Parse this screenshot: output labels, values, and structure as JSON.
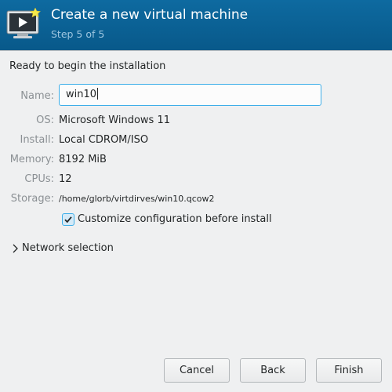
{
  "header": {
    "title": "Create a new virtual machine",
    "step": "Step 5 of 5",
    "icon": "monitor-play-icon",
    "colors": {
      "background": "#0c6296",
      "title": "#ffffff",
      "step": "#9ec6e0"
    }
  },
  "section_title": "Ready to begin the installation",
  "fields": {
    "name": {
      "label": "Name:",
      "value": "win10"
    },
    "os": {
      "label": "OS:",
      "value": "Microsoft Windows 11"
    },
    "install": {
      "label": "Install:",
      "value": "Local CDROM/ISO"
    },
    "memory": {
      "label": "Memory:",
      "value": "8192 MiB"
    },
    "cpus": {
      "label": "CPUs:",
      "value": "12"
    },
    "storage": {
      "label": "Storage:",
      "value": "/home/glorb/virtdirves/win10.qcow2"
    }
  },
  "customize_checkbox": {
    "label": "Customize configuration before install",
    "checked": true
  },
  "network_expander": {
    "label": "Network selection",
    "expanded": false,
    "icon": "chevron-right-icon"
  },
  "buttons": {
    "cancel": "Cancel",
    "back": "Back",
    "finish": "Finish"
  },
  "accent_color": "#3daee9"
}
